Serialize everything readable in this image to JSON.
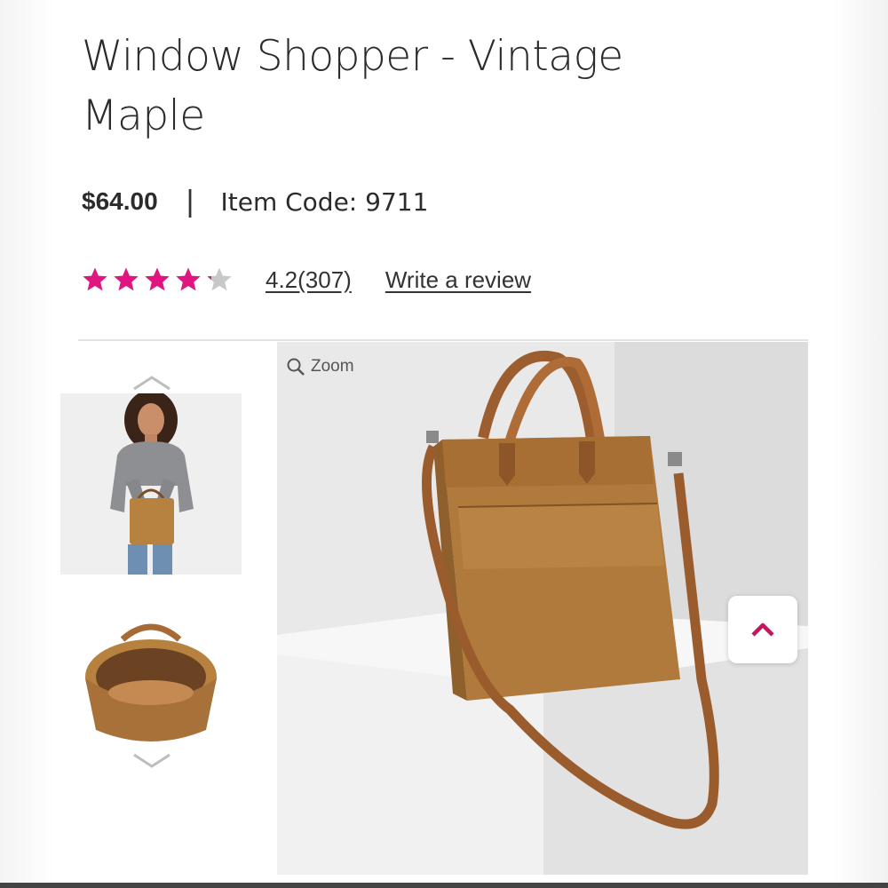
{
  "product": {
    "title": "Window Shopper - Vintage Maple",
    "price": "$64.00",
    "separator": "|",
    "item_code": "Item Code: 9711",
    "rating": {
      "value": 4.2,
      "stars_max": 5,
      "link_text": "4.2(307)",
      "write_review": "Write a review"
    }
  },
  "gallery": {
    "zoom_label": "Zoom",
    "thumbnails": [
      {
        "name": "model-holding-bag"
      },
      {
        "name": "bag-interior-top-view"
      }
    ],
    "active_index": 0
  },
  "colors": {
    "star_filled": "#e0157f",
    "star_empty": "#c8c8c8",
    "accent": "#c2185b",
    "bag": "#b07a3c"
  },
  "icons": {
    "zoom": "magnifier-icon",
    "prev": "chevron-up-icon",
    "next": "chevron-down-icon",
    "back_to_top": "chevron-up-icon"
  }
}
